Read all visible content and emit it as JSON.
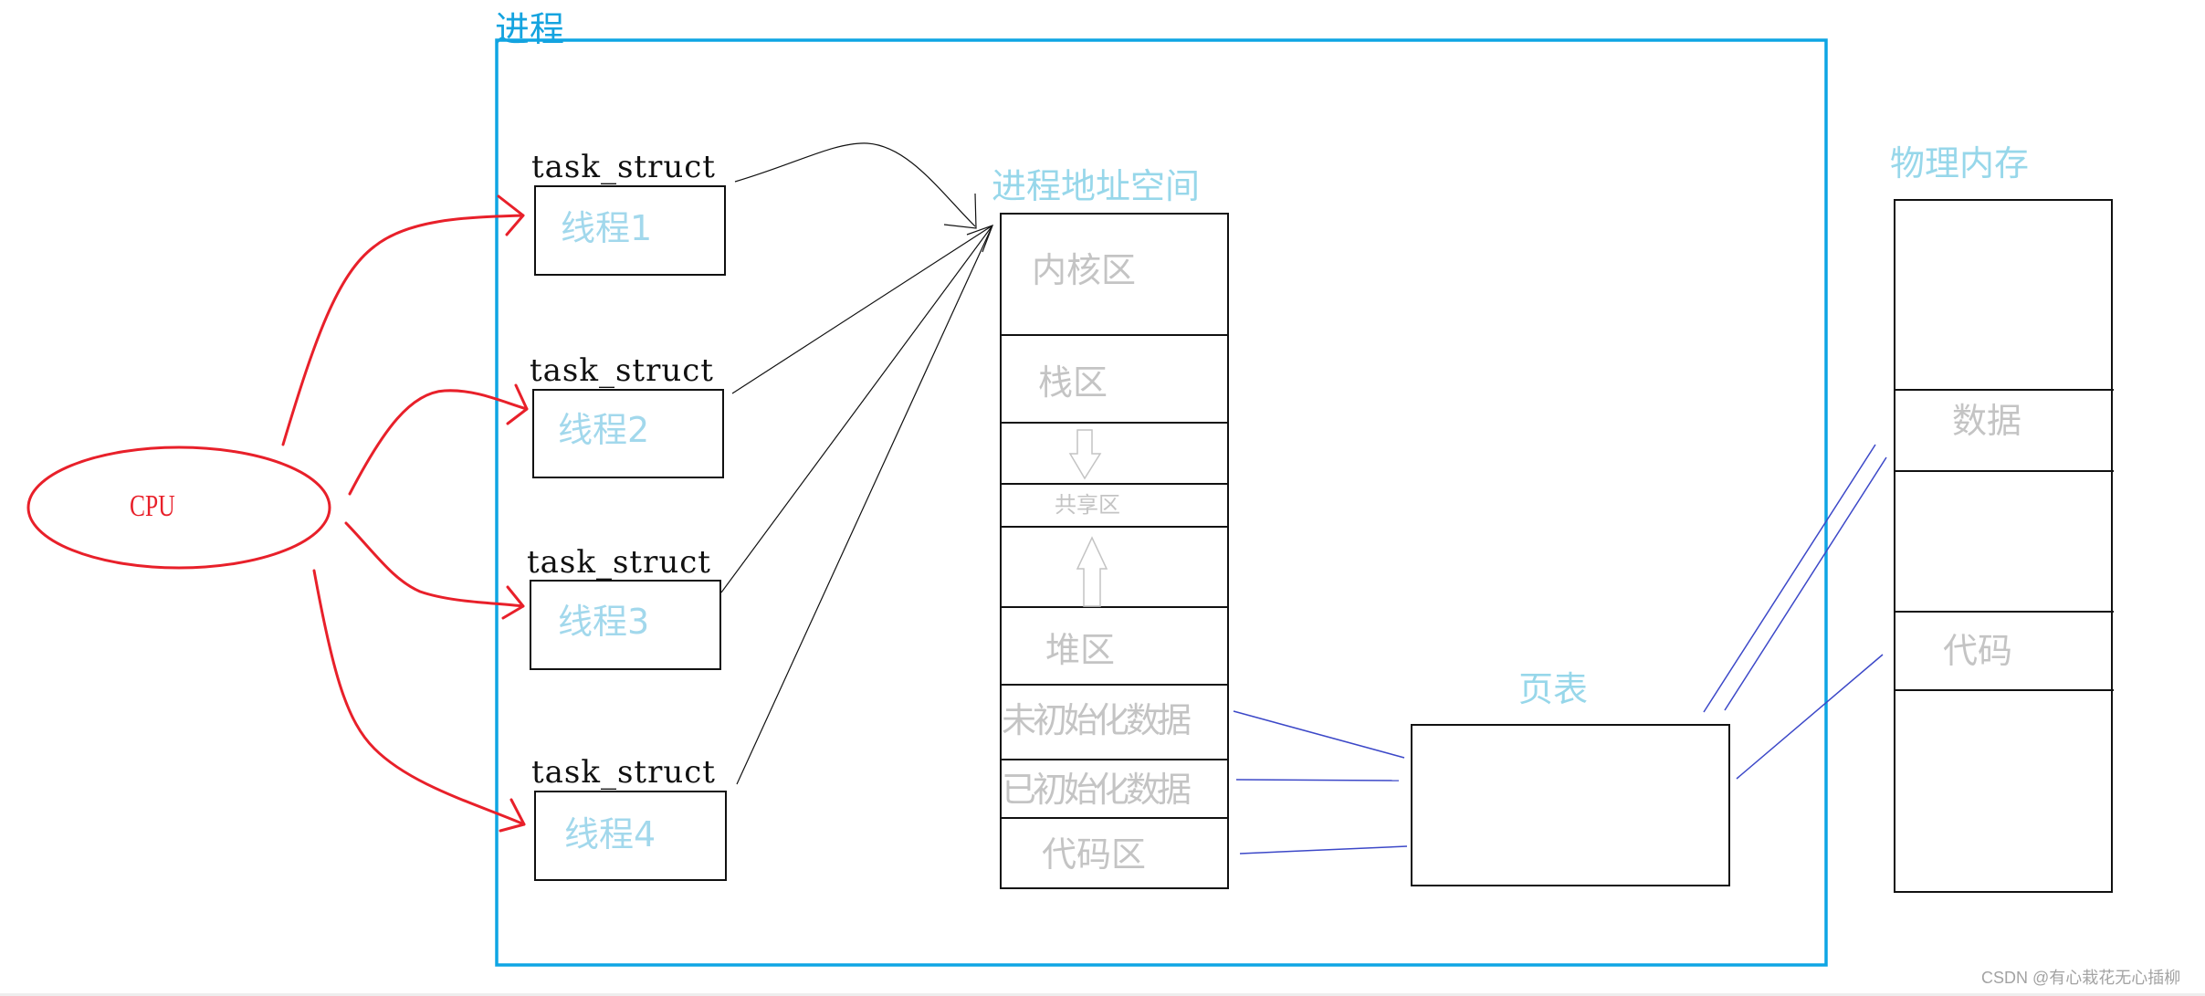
{
  "process": {
    "title": "进程",
    "frame_color": "#0ea5e4"
  },
  "cpu": {
    "label": "CPU",
    "color": "#e8202a"
  },
  "threads": [
    {
      "struct_label": "task_struct",
      "label": "线程1"
    },
    {
      "struct_label": "task_struct",
      "label": "线程2"
    },
    {
      "struct_label": "task_struct",
      "label": "线程3"
    },
    {
      "struct_label": "task_struct",
      "label": "线程4"
    }
  ],
  "address_space": {
    "title": "进程地址空间",
    "segments": [
      {
        "label": "内核区"
      },
      {
        "label": "栈区"
      },
      {
        "label": "",
        "icon": "arrow-down-icon"
      },
      {
        "label": "共享区"
      },
      {
        "label": "",
        "icon": "arrow-up-icon"
      },
      {
        "label": "堆区"
      },
      {
        "label": "未初始化数据"
      },
      {
        "label": "已初始化数据"
      },
      {
        "label": "代码区"
      }
    ]
  },
  "page_table": {
    "title": "页表"
  },
  "physical_memory": {
    "title": "物理内存",
    "segments": [
      {
        "label": ""
      },
      {
        "label": "数据"
      },
      {
        "label": ""
      },
      {
        "label": "代码"
      },
      {
        "label": ""
      }
    ]
  },
  "mapping_color": "#3c48c8",
  "watermark": "CSDN @有心栽花无心插柳"
}
